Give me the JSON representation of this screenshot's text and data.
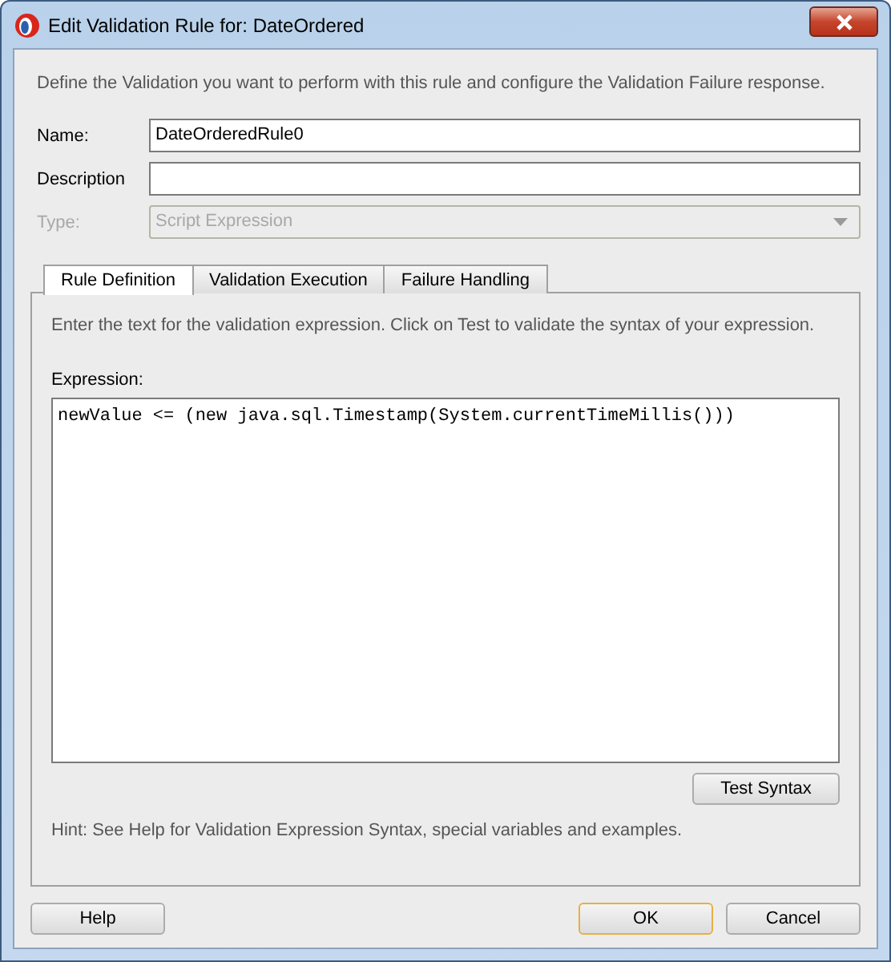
{
  "window": {
    "title": "Edit Validation Rule for: DateOrdered"
  },
  "intro": "Define the Validation you want to perform with this rule and configure the Validation Failure response.",
  "fields": [
    {
      "kind": "text",
      "label": "Name:",
      "value": "DateOrderedRule0",
      "disabled": false
    },
    {
      "kind": "text",
      "label": "Description",
      "disabled": false
    },
    {
      "kind": "dropdown",
      "label": "Type:",
      "value": "Script Expression",
      "disabled": true
    }
  ],
  "tabs": [
    {
      "label": "Rule Definition",
      "selected": true
    },
    {
      "label": "Validation Execution",
      "selected": false
    },
    {
      "label": "Failure Handling",
      "selected": false
    }
  ],
  "panel": {
    "instruction": "Enter the text for the validation expression. Click on Test to validate the syntax of your expression.",
    "expression_label": "Expression:",
    "expression": "newValue <= (new java.sql.Timestamp(System.currentTimeMillis()))",
    "test_button": "Test Syntax",
    "hint": "Hint: See Help for Validation Expression Syntax, special variables and examples."
  },
  "buttons": [
    {
      "label": "Help",
      "default": false
    },
    {
      "label": "OK",
      "default": true
    },
    {
      "label": "Cancel",
      "default": false
    }
  ]
}
